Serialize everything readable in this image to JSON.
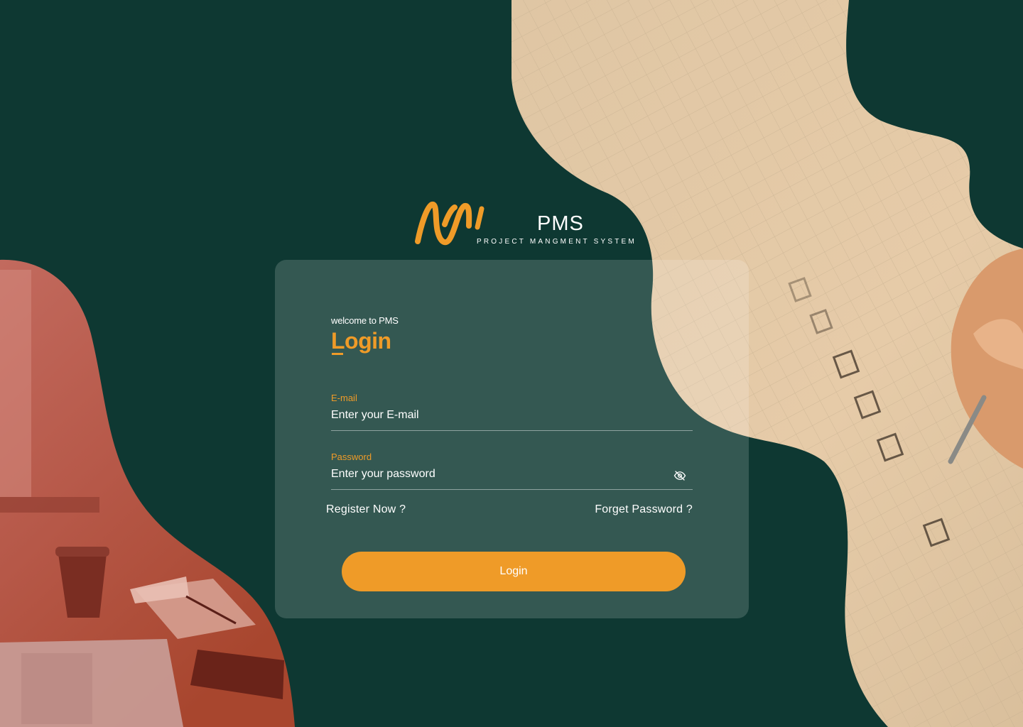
{
  "brand": {
    "name": "PMS",
    "tagline": "PROJECT MANGMENT SYSTEM",
    "accent_color": "#ef9b28",
    "background_color": "#0e3832"
  },
  "login_card": {
    "welcome_text": "welcome to PMS",
    "title": "Login",
    "email": {
      "label": "E-mail",
      "placeholder": "Enter your E-mail",
      "value": ""
    },
    "password": {
      "label": "Password",
      "placeholder": "Enter your password",
      "value": "",
      "toggle_icon": "eye-off-icon"
    },
    "register_link": "Register Now ?",
    "forget_link": "Forget Password ?",
    "submit_label": "Login"
  },
  "decorations": {
    "left_image": "desk-with-laptop-coffee-notepad",
    "right_image": "hand-writing-checklist"
  }
}
